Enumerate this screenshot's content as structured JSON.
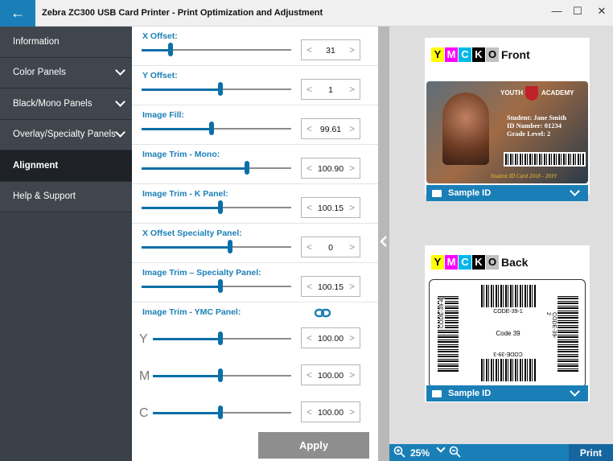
{
  "window": {
    "title": "Zebra ZC300 USB Card Printer - Print Optimization and Adjustment",
    "minimize": "—",
    "maximize": "☐",
    "close": "✕",
    "back_icon": "←"
  },
  "sidebar": {
    "items": [
      {
        "label": "Information"
      },
      {
        "label": "Color Panels"
      },
      {
        "label": "Black/Mono Panels"
      },
      {
        "label": "Overlay/Specialty Panels"
      },
      {
        "label": "Alignment"
      },
      {
        "label": "Help & Support"
      }
    ]
  },
  "controls": {
    "x_offset": {
      "label": "X Offset:",
      "value": "31"
    },
    "y_offset": {
      "label": "Y Offset:",
      "value": "1"
    },
    "image_fill": {
      "label": "Image Fill:",
      "value": "99.61"
    },
    "trim_mono": {
      "label": "Image Trim - Mono:",
      "value": "100.90"
    },
    "trim_k": {
      "label": "Image Trim - K Panel:",
      "value": "100.15"
    },
    "x_offset_specialty": {
      "label": "X Offset Specialty Panel:",
      "value": "0"
    },
    "trim_specialty": {
      "label": "Image Trim – Specialty Panel:",
      "value": "100.15"
    },
    "trim_ymc": {
      "label": "Image Trim - YMC Panel:",
      "y_label": "Y",
      "m_label": "M",
      "c_label": "C",
      "y_value": "100.00",
      "m_value": "100.00",
      "c_value": "100.00"
    },
    "apply": "Apply"
  },
  "preview": {
    "front": {
      "panels": [
        "Y",
        "M",
        "C",
        "K",
        "O"
      ],
      "label": "Front",
      "dropdown": "Sample ID",
      "card": {
        "school_a": "YOUTH",
        "school_b": "ACADEMY",
        "student": "Student: Jane Smith",
        "id": "ID Number: 01234",
        "grade": "Grade Level: 2",
        "footer": "Student ID Card 2018 - 2019"
      }
    },
    "back": {
      "panels": [
        "Y",
        "M",
        "C",
        "K",
        "O"
      ],
      "label": "Back",
      "dropdown": "Sample ID",
      "card": {
        "code_top": "CODE-39-1",
        "code_mid": "Code 39",
        "code_bottom": "CODE-39-3",
        "code_left": "CODE-39-4",
        "code_right": "CODE-39-2"
      }
    }
  },
  "zoom": {
    "value": "25%",
    "print": "Print"
  },
  "colors": {
    "accent": "#1b7fb7",
    "sidebar": "#3f464d",
    "y": "#ffff00",
    "m": "#ff00ff",
    "c": "#00b7eb",
    "k": "#000000",
    "o": "#c0c0c0"
  }
}
